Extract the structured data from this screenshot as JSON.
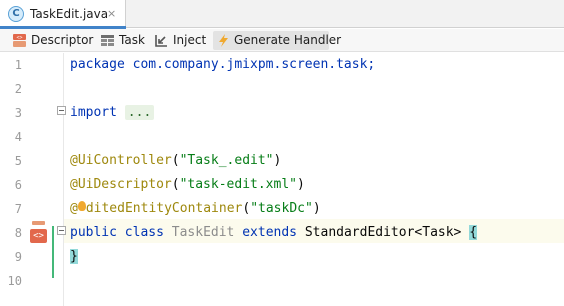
{
  "tab": {
    "file_icon_letter": "C",
    "title": "TaskEdit.java",
    "close": "×"
  },
  "toolbar": {
    "descriptor": "Descriptor",
    "task": "Task",
    "inject": "Inject",
    "generate_handler": "Generate Handler"
  },
  "editor": {
    "gutter_icon_text": "<>",
    "lines": [
      {
        "n": "1",
        "text": "package com.company.jmixpm.screen.task;"
      },
      {
        "n": "2",
        "text": ""
      },
      {
        "n": "3",
        "import_kw": "import",
        "import_ellipsis": "..."
      },
      {
        "n": "4",
        "text": ""
      },
      {
        "n": "5",
        "text": ""
      },
      {
        "n": "6",
        "ann": "@UiController",
        "open": "(",
        "str": "\"Task_.edit\"",
        "close": ")"
      },
      {
        "n": "7",
        "ann": "@UiDescriptor",
        "open": "(",
        "str": "\"task-edit.xml\"",
        "close": ")"
      },
      {
        "n": "8",
        "ann_a": "@",
        "ann_b": "ditedEntityContainer",
        "open": "(",
        "str": "\"taskDc\"",
        "close": ")"
      },
      {
        "n": "9",
        "kw1": "public",
        "kw2": "class",
        "name": "TaskEdit",
        "kw3": "extends",
        "rest": "StandardEditor<Task>",
        "brace": "{"
      },
      {
        "n": "10",
        "brace": "}"
      }
    ]
  },
  "colors": {
    "keyword": "#0033b3",
    "annotation": "#9e880d",
    "string": "#067d17",
    "accent_tab": "#4083c9",
    "brace_highlight": "#93d9d9"
  },
  "icons": [
    "java-class-icon",
    "descriptor-icon",
    "task-icon",
    "inject-icon",
    "lightning-icon",
    "xml-gutter-icon",
    "intention-bulb-icon"
  ]
}
